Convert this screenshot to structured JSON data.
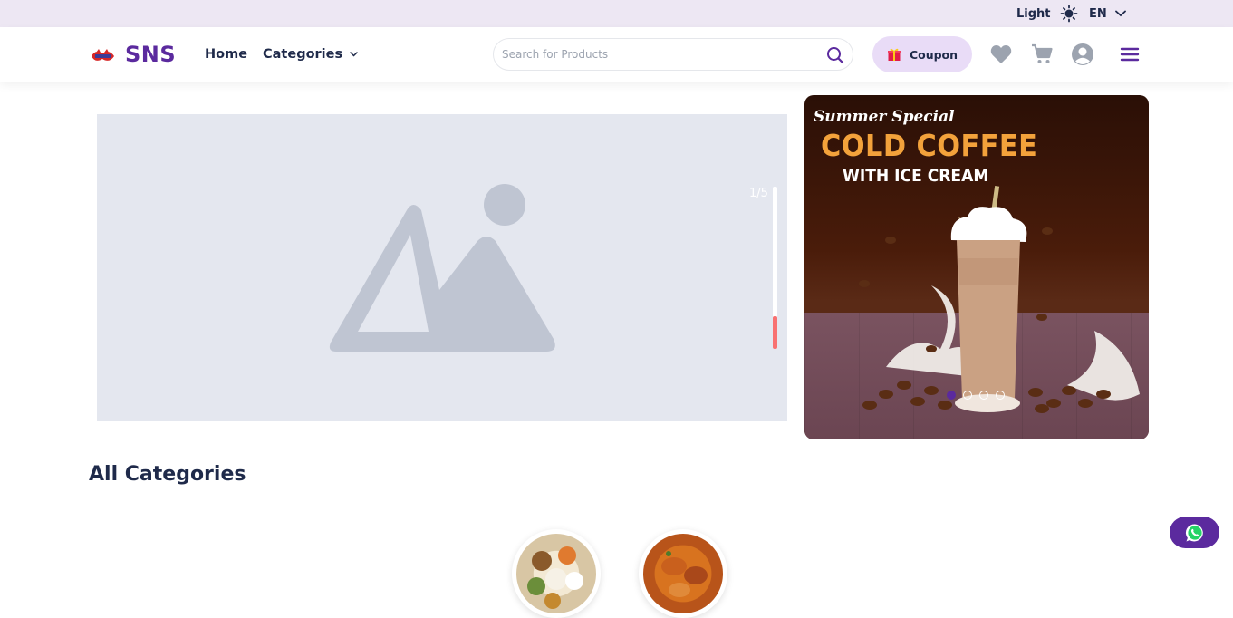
{
  "topbar": {
    "theme_label": "Light",
    "language_label": "EN"
  },
  "header": {
    "brand": "SNS",
    "nav": {
      "home": "Home",
      "categories": "Categories"
    },
    "search": {
      "placeholder": "Search for Products"
    },
    "coupon_label": "Coupon",
    "icons": [
      "heart-icon",
      "cart-icon",
      "user-icon",
      "menu-icon"
    ]
  },
  "hero": {
    "slide_counter": "1/5",
    "progress_fraction": 0.2
  },
  "promo": {
    "script_text": "Summer Special",
    "title": "COLD COFFEE",
    "subtitle": "WITH ICE CREAM",
    "slides": 4,
    "active_slide": 1
  },
  "categories": {
    "title": "All Categories"
  },
  "colors": {
    "brand": "#5b2a9e",
    "accent": "#f3a23b",
    "topbar_bg": "#ede7f3",
    "coupon_bg": "#e9dcf7"
  }
}
